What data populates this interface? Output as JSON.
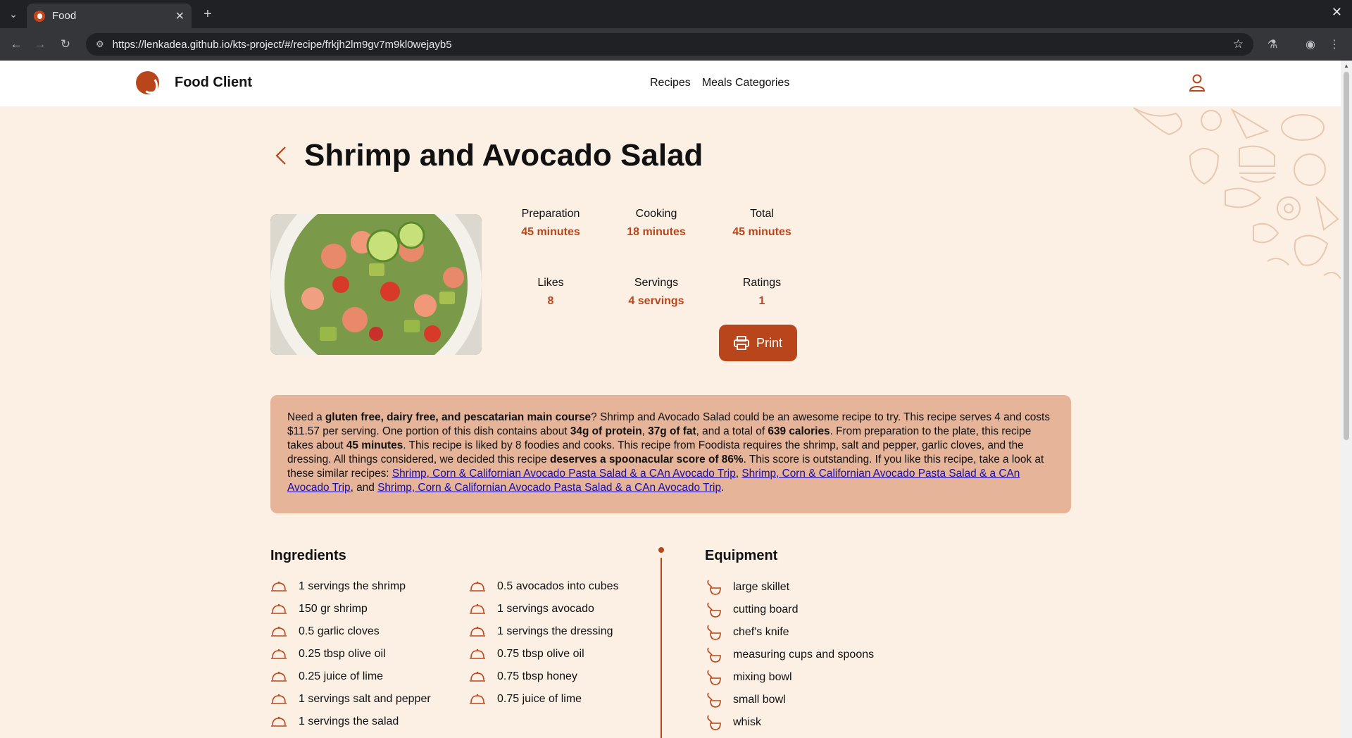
{
  "browser": {
    "tab_title": "Food",
    "url": "https://lenkadea.github.io/kts-project/#/recipe/frkjh2lm9gv7m9kl0wejayb5"
  },
  "header": {
    "brand": "Food Client",
    "nav": [
      "Recipes",
      "Meals Categories"
    ]
  },
  "recipe": {
    "title": "Shrimp and Avocado Salad",
    "stats": [
      {
        "label": "Preparation",
        "value": "45 minutes"
      },
      {
        "label": "Cooking",
        "value": "18 minutes"
      },
      {
        "label": "Total",
        "value": "45 minutes"
      },
      {
        "label": "Likes",
        "value": "8"
      },
      {
        "label": "Servings",
        "value": "4 servings"
      },
      {
        "label": "Ratings",
        "value": "1"
      }
    ],
    "print_label": "Print",
    "summary": {
      "t1": "Need a ",
      "b1": "gluten free, dairy free, and pescatarian main course",
      "t2": "? Shrimp and Avocado Salad could be an awesome recipe to try. This recipe serves 4 and costs $11.57 per serving. One portion of this dish contains about ",
      "b2": "34g of protein",
      "t3": ", ",
      "b3": "37g of fat",
      "t4": ", and a total of ",
      "b4": "639 calories",
      "t5": ". From preparation to the plate, this recipe takes about ",
      "b5": "45 minutes",
      "t6": ". This recipe is liked by 8 foodies and cooks. This recipe from Foodista requires the shrimp, salt and pepper, garlic cloves, and the dressing. All things considered, we decided this recipe ",
      "b6": "deserves a spoonacular score of 86%",
      "t7": ". This score is outstanding. If you like this recipe, take a look at these similar recipes: ",
      "link1": "Shrimp, Corn & Californian Avocado Pasta Salad & a CAn Avocado Trip",
      "t8": ", ",
      "link2": "Shrimp, Corn & Californian Avocado Pasta Salad & a CAn Avocado Trip",
      "t9": ", and ",
      "link3": "Shrimp, Corn & Californian Avocado Pasta Salad & a CAn Avocado Trip",
      "t10": "."
    },
    "ingredients_title": "Ingredients",
    "ingredients_col1": [
      "1 servings the shrimp",
      "150 gr shrimp",
      "0.5 garlic cloves",
      "0.25 tbsp olive oil",
      "0.25 juice of lime",
      "1 servings salt and pepper",
      "1 servings the salad"
    ],
    "ingredients_col2": [
      "0.5 avocados into cubes",
      "1 servings avocado",
      "1 servings the dressing",
      "0.75 tbsp olive oil",
      "0.75 tbsp honey",
      "0.75 juice of lime"
    ],
    "equipment_title": "Equipment",
    "equipment": [
      "large skillet",
      "cutting board",
      "chef's knife",
      "measuring cups and spoons",
      "mixing bowl",
      "small bowl",
      "whisk"
    ]
  },
  "colors": {
    "accent": "#b9461b",
    "page_bg": "#fcefe3",
    "summary_bg": "#e6b498"
  }
}
